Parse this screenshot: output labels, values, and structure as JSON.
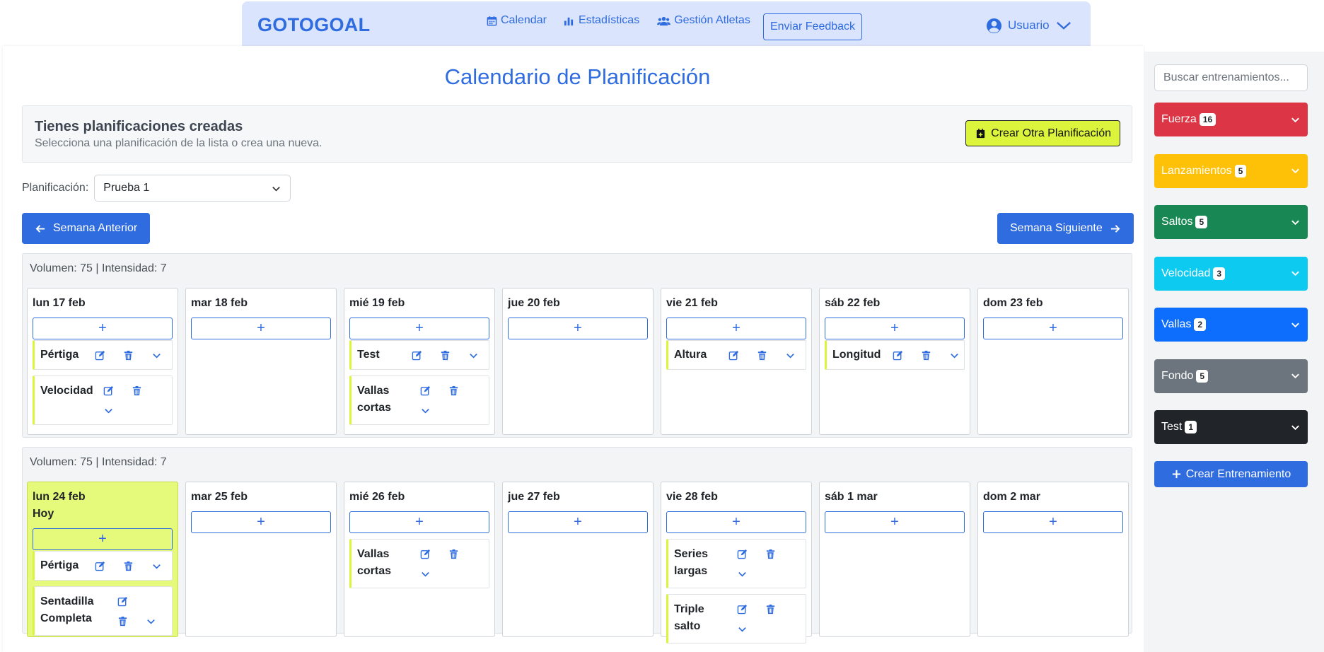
{
  "nav": {
    "brand": "GOTOGOAL",
    "links": [
      {
        "label": "Calendar",
        "icon": "calendar-icon"
      },
      {
        "label": "Estadísticas",
        "icon": "bar-chart-icon"
      },
      {
        "label": "Gestión Atletas",
        "icon": "users-icon"
      }
    ],
    "feedback": "Enviar Feedback",
    "user": "Usuario"
  },
  "page": {
    "title": "Calendario de Planificación",
    "info_title": "Tienes planificaciones creadas",
    "info_text": "Selecciona una planificación de la lista o crea una nueva.",
    "create_plan": "Crear Otra Planificación",
    "plan_label": "Planificación:",
    "plan_value": "Prueba 1",
    "prev_week": "Semana Anterior",
    "next_week": "Semana Siguiente",
    "add_symbol": "+"
  },
  "weeks": [
    {
      "header": "Volumen: 75 | Intensidad: 7",
      "days": [
        {
          "name": "lun 17 feb",
          "today_label": "",
          "entries": [
            {
              "name": "Pértiga",
              "layout": "inline"
            },
            {
              "name": "Velocidad",
              "layout": "stacked"
            }
          ]
        },
        {
          "name": "mar 18 feb",
          "today_label": "",
          "entries": []
        },
        {
          "name": "mié 19 feb",
          "today_label": "",
          "entries": [
            {
              "name": "Test",
              "layout": "inline"
            },
            {
              "name": "Vallas cortas",
              "layout": "stacked"
            }
          ]
        },
        {
          "name": "jue 20 feb",
          "today_label": "",
          "entries": []
        },
        {
          "name": "vie 21 feb",
          "today_label": "",
          "entries": [
            {
              "name": "Altura",
              "layout": "inline"
            }
          ]
        },
        {
          "name": "sáb 22 feb",
          "today_label": "",
          "entries": [
            {
              "name": "Longitud",
              "layout": "inline"
            }
          ]
        },
        {
          "name": "dom 23 feb",
          "today_label": "",
          "entries": []
        }
      ]
    },
    {
      "header": "Volumen: 75 | Intensidad: 7",
      "days": [
        {
          "name": "lun 24 feb",
          "today_label": "Hoy",
          "entries": [
            {
              "name": "Pértiga",
              "layout": "inline"
            },
            {
              "name": "Sentadilla Completa",
              "layout": "stacked2"
            }
          ]
        },
        {
          "name": "mar 25 feb",
          "today_label": "",
          "entries": []
        },
        {
          "name": "mié 26 feb",
          "today_label": "",
          "entries": [
            {
              "name": "Vallas cortas",
              "layout": "stacked"
            }
          ]
        },
        {
          "name": "jue 27 feb",
          "today_label": "",
          "entries": []
        },
        {
          "name": "vie 28 feb",
          "today_label": "",
          "entries": [
            {
              "name": "Series largas",
              "layout": "stacked"
            },
            {
              "name": "Triple salto",
              "layout": "stacked"
            }
          ]
        },
        {
          "name": "sáb 1 mar",
          "today_label": "",
          "entries": []
        },
        {
          "name": "dom 2 mar",
          "today_label": "",
          "entries": []
        }
      ]
    }
  ],
  "sidebar": {
    "search_placeholder": "Buscar entrenamientos...",
    "categories": [
      {
        "label": "Fuerza",
        "count": "16",
        "color": "#dc3545"
      },
      {
        "label": "Lanzamientos",
        "count": "5",
        "color": "#ffc107"
      },
      {
        "label": "Saltos",
        "count": "5",
        "color": "#198754"
      },
      {
        "label": "Velocidad",
        "count": "3",
        "color": "#0dcaf0"
      },
      {
        "label": "Vallas",
        "count": "2",
        "color": "#0d6efd"
      },
      {
        "label": "Fondo",
        "count": "5",
        "color": "#6c757d"
      },
      {
        "label": "Test",
        "count": "1",
        "color": "#212529"
      }
    ],
    "create_training": "Crear Entrenamiento"
  }
}
